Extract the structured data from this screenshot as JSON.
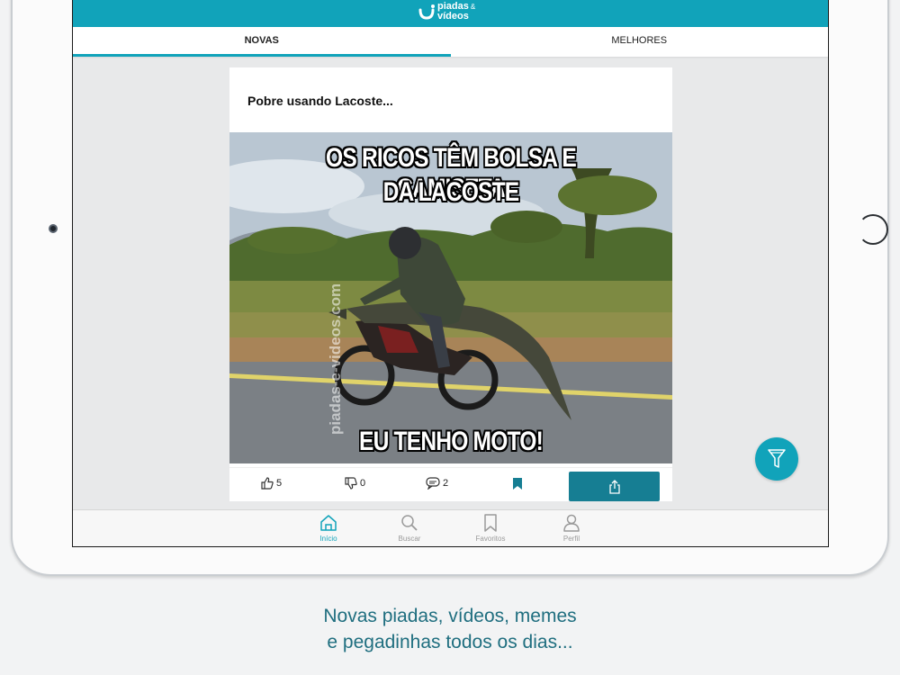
{
  "app": {
    "logo_text_line1": "piadas",
    "logo_amp": "&",
    "logo_text_line2": "vídeos"
  },
  "tabs": [
    {
      "label": "NOVAS",
      "active": true
    },
    {
      "label": "MELHORES",
      "active": false
    }
  ],
  "post": {
    "title": "Pobre usando Lacoste...",
    "meme_top_line1": "OS RICOS TÊM BOLSA E CAMISETA",
    "meme_top_line2": "DA LACOSTE",
    "meme_bottom": "EU TENHO MOTO!",
    "watermark": "piadas-e-videos.com",
    "likes": "5",
    "dislikes": "0",
    "comments": "2"
  },
  "bottom_nav": [
    {
      "label": "Início",
      "icon": "home-icon",
      "active": true
    },
    {
      "label": "Buscar",
      "icon": "search-icon",
      "active": false
    },
    {
      "label": "Favoritos",
      "icon": "bookmark-icon",
      "active": false
    },
    {
      "label": "Perfil",
      "icon": "profile-icon",
      "active": false
    }
  ],
  "tagline": {
    "line1": "Novas piadas, vídeos, memes",
    "line2": "e pegadinhas todos os dias..."
  },
  "colors": {
    "accent": "#11a3ba",
    "share_button": "#167e93",
    "tagline": "#1f6e7f"
  }
}
